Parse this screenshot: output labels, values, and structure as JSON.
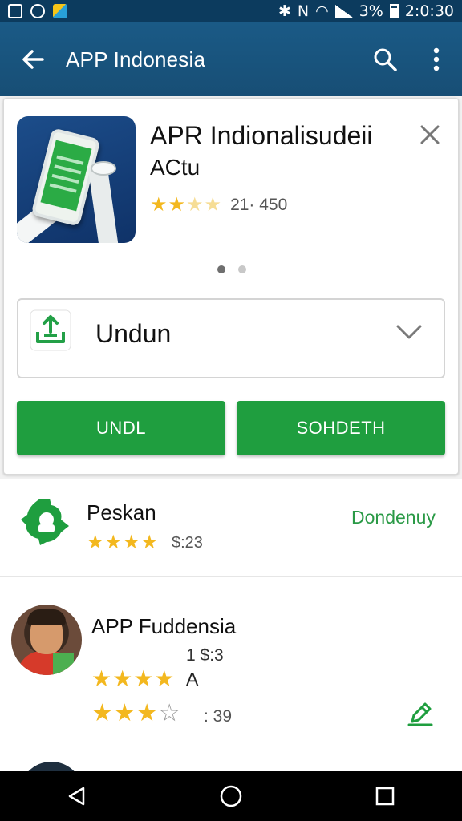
{
  "status_bar": {
    "battery": "3%",
    "time": "2:0:30"
  },
  "app_bar": {
    "title": "APP Indonesia",
    "icons": [
      "back-arrow-icon",
      "search-icon",
      "more-vert-icon"
    ]
  },
  "card": {
    "app_name": "APR Indionalisudeii",
    "app_subtitle": "ACtu",
    "rating": "★★★★★",
    "rating_count": "21· 450",
    "download_select": {
      "label": "Undun",
      "icon": "download-tray-icon"
    },
    "buttons": {
      "left": "UNDL",
      "right": "SOHDETH"
    }
  },
  "list": [
    {
      "title": "Peskan",
      "stars": "★★★★",
      "count": "$:23",
      "action": "Dondenuy"
    },
    {
      "title": "APP Fuddensia",
      "price": "1 $:3",
      "stars_a": "★★★★",
      "note": "A",
      "stars_b": "★★★",
      "stars_b_empty": "☆",
      "count": ": 39"
    }
  ],
  "colors": {
    "app_bar": "#1a5a86",
    "status_bar": "#0c3b5e",
    "accent_green": "#1f9e3f",
    "star": "#f3b81f"
  }
}
